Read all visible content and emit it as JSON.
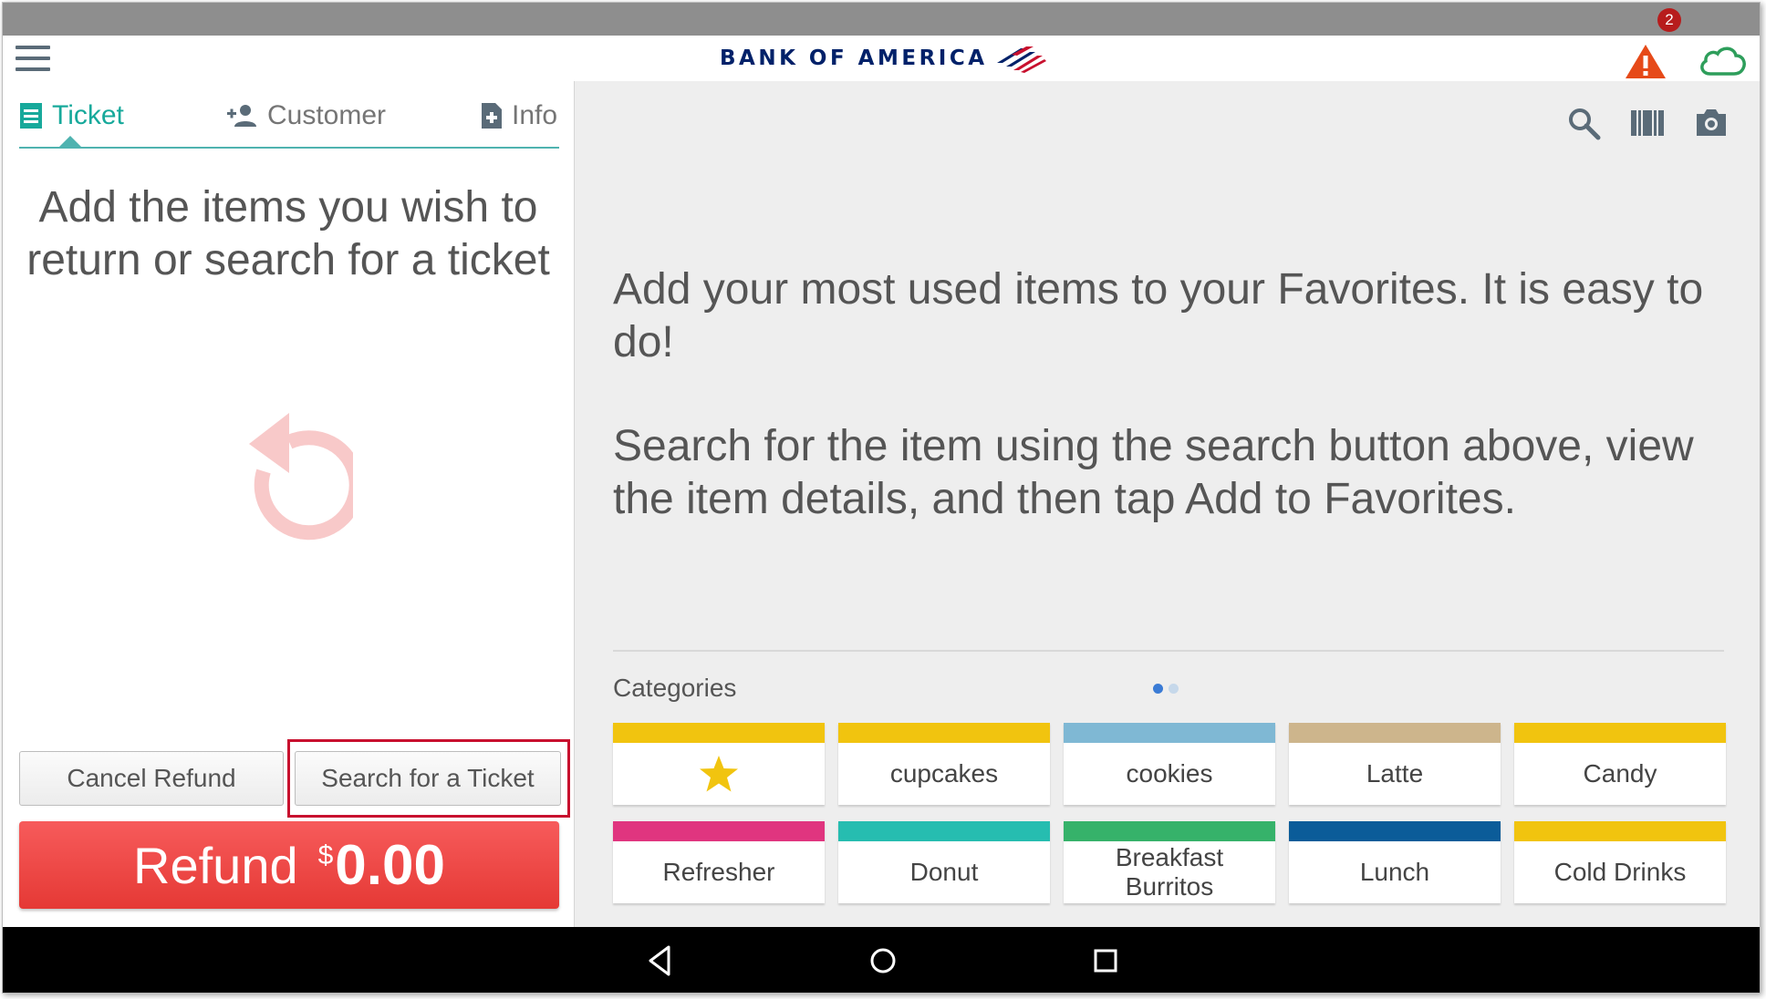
{
  "header": {
    "logo_text": "BANK OF AMERICA",
    "alert_count": "2",
    "colors": {
      "brand_navy": "#012169",
      "brand_red": "#c8102e",
      "alert": "#e64a19",
      "cloud": "#2e9e5b"
    }
  },
  "left_panel": {
    "tabs": [
      {
        "label": "Ticket",
        "icon": "ticket-icon"
      },
      {
        "label": "Customer",
        "icon": "add-person-icon"
      },
      {
        "label": "Info",
        "icon": "add-document-icon"
      }
    ],
    "message": "Add the items you wish to return or search for a ticket",
    "return_icon": "return-arrow-icon",
    "cancel_refund_label": "Cancel Refund",
    "search_ticket_label": "Search for a Ticket",
    "refund_label": "Refund",
    "refund_currency": "$",
    "refund_amount": "0.00",
    "colors": {
      "accent": "#17a99b",
      "refund": "#e53935"
    }
  },
  "right_panel": {
    "icons": [
      "search-icon",
      "barcode-icon",
      "camera-icon"
    ],
    "favorites_text_1": "Add your most used items to your Favorites. It is easy to do!",
    "favorites_text_2": "Search for the item using the search button above, view the item details, and then tap Add to Favorites.",
    "categories_title": "Categories",
    "page_dots": 2,
    "active_page": 1,
    "categories": [
      {
        "label": "",
        "icon": "star-icon",
        "color": "#f1c40f"
      },
      {
        "label": "cupcakes",
        "color": "#f1c40f"
      },
      {
        "label": "cookies",
        "color": "#7fb8d4"
      },
      {
        "label": "Latte",
        "color": "#cdb58c"
      },
      {
        "label": "Candy",
        "color": "#f1c40f"
      },
      {
        "label": "Refresher",
        "color": "#e0357f"
      },
      {
        "label": "Donut",
        "color": "#26bdb0"
      },
      {
        "label": "Breakfast Burritos",
        "color": "#36b26a"
      },
      {
        "label": "Lunch",
        "color": "#0b5c99"
      },
      {
        "label": "Cold Drinks",
        "color": "#f1c40f"
      }
    ]
  },
  "nav_bar": {
    "buttons": [
      "back-icon",
      "home-icon",
      "recents-icon"
    ]
  }
}
